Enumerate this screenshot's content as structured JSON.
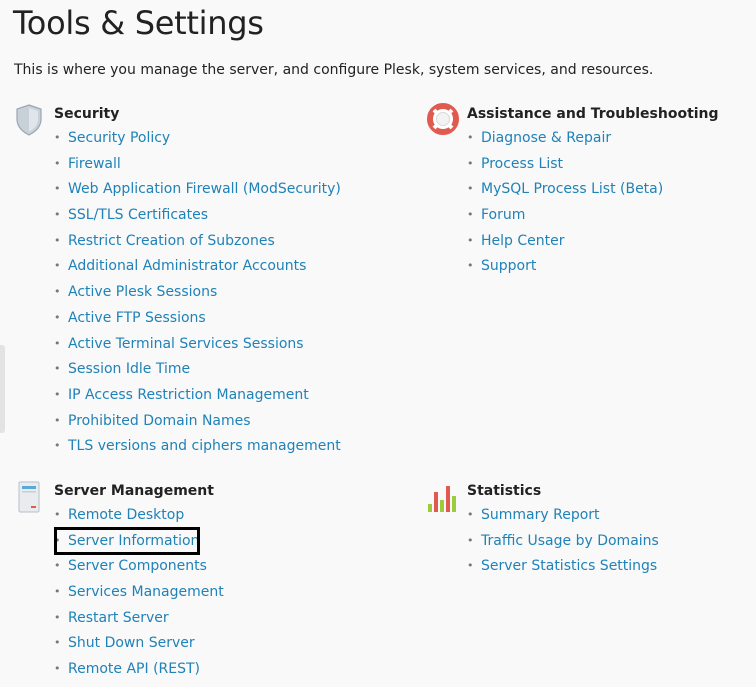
{
  "page": {
    "title": "Tools & Settings",
    "description": "This is where you manage the server, and configure Plesk, system services, and resources."
  },
  "sections": {
    "security": {
      "title": "Security",
      "icon": "shield-icon",
      "items": [
        "Security Policy",
        "Firewall",
        "Web Application Firewall (ModSecurity)",
        "SSL/TLS Certificates",
        "Restrict Creation of Subzones",
        "Additional Administrator Accounts",
        "Active Plesk Sessions",
        "Active FTP Sessions",
        "Active Terminal Services Sessions",
        "Session Idle Time",
        "IP Access Restriction Management",
        "Prohibited Domain Names",
        "TLS versions and ciphers management"
      ]
    },
    "assistance": {
      "title": "Assistance and Troubleshooting",
      "icon": "lifebuoy-icon",
      "items": [
        "Diagnose & Repair",
        "Process List",
        "MySQL Process List (Beta)",
        "Forum",
        "Help Center",
        "Support"
      ]
    },
    "server": {
      "title": "Server Management",
      "icon": "server-icon",
      "items": [
        "Remote Desktop",
        "Server Information",
        "Server Components",
        "Services Management",
        "Restart Server",
        "Shut Down Server",
        "Remote API (REST)"
      ]
    },
    "statistics": {
      "title": "Statistics",
      "icon": "bar-chart-icon",
      "items": [
        "Summary Report",
        "Traffic Usage by Domains",
        "Server Statistics Settings"
      ]
    }
  },
  "colors": {
    "link": "#1f82b8",
    "highlight_border": "#000000"
  }
}
